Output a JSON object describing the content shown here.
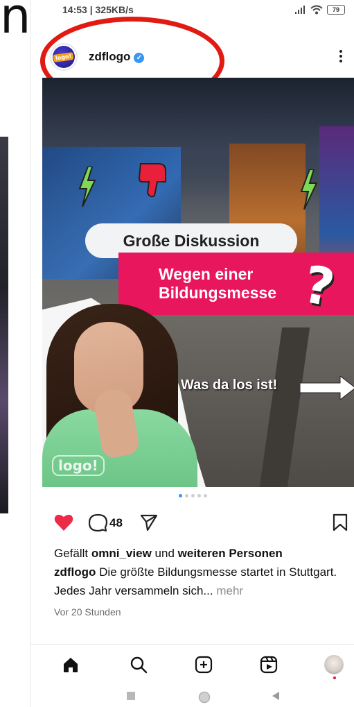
{
  "background": {
    "partial_title": "n"
  },
  "status_bar": {
    "time_speed": "14:53 | 325KB/s",
    "battery": "79"
  },
  "post": {
    "username": "zdflogo",
    "avatar_text": "logo!",
    "image": {
      "headline": "Große Diskussion",
      "subline_1": "Wegen einer",
      "subline_2": "Bildungsmesse",
      "arrow_text": "Was da los ist!",
      "watermark": "logo!"
    },
    "carousel": {
      "total": 5,
      "active_index": 0
    },
    "comment_count": "48",
    "likes": {
      "prefix": "Gefällt",
      "user": "omni_view",
      "connector": "und",
      "others": "weiteren Personen"
    },
    "caption": {
      "author": "zdflogo",
      "text": "Die größte Bildungsmesse startet in Stuttgart. Jedes Jahr versammeln sich...",
      "more": "mehr"
    },
    "timestamp": "Vor 20 Stunden"
  },
  "colors": {
    "like_red": "#ed2b48",
    "verified_blue": "#3897f0",
    "annotation_red": "#e11a12",
    "pink_box": "#e8175d"
  },
  "bottom_nav": [
    "home-icon",
    "search-icon",
    "create-icon",
    "reels-icon",
    "profile-avatar"
  ]
}
